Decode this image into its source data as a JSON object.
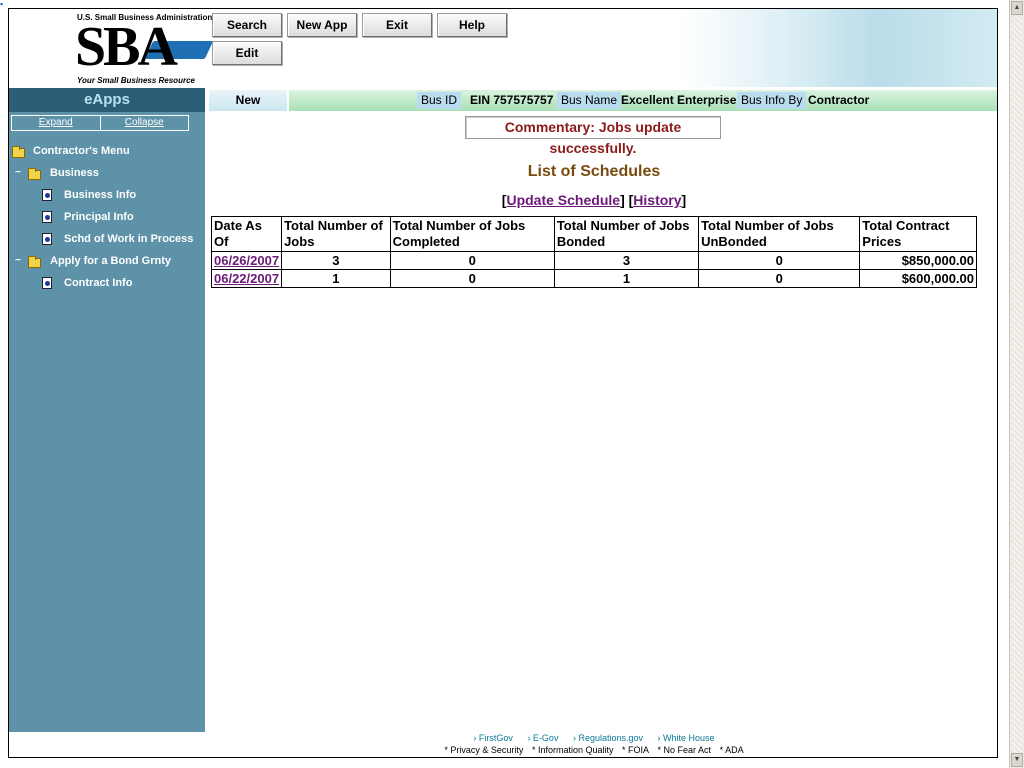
{
  "logo": {
    "tagline_top": "U.S. Small Business Administration",
    "wordmark": "SBA",
    "tagline_bottom": "Your Small Business Resource"
  },
  "toolbar": {
    "search_label": "Search",
    "new_app_label": "New App",
    "exit_label": "Exit",
    "help_label": "Help",
    "edit_label": "Edit"
  },
  "sidebar": {
    "title": "eApps",
    "expand": "Expand",
    "collapse": "Collapse",
    "items": [
      {
        "label": "Contractor's Menu"
      },
      {
        "label": "Business"
      },
      {
        "label": "Business Info"
      },
      {
        "label": "Principal Info"
      },
      {
        "label": "Schd of Work in Process"
      },
      {
        "label": "Apply for a Bond Grnty"
      },
      {
        "label": "Contract Info"
      }
    ]
  },
  "infobar": {
    "status": "New",
    "bus_id_label": "Bus ID",
    "bus_id_value": "EIN  757575757",
    "bus_name_label": "Bus Name",
    "bus_name_value": "Excellent Enterprise",
    "bus_info_by_label": "Bus Info By",
    "bus_info_by_value": "Contractor"
  },
  "commentary": "Commentary: Jobs update successfully.",
  "main": {
    "title": "List of Schedules",
    "update_link": "Update Schedule",
    "history_link": "History"
  },
  "table": {
    "headers": [
      "Date As Of",
      "Total Number of Jobs",
      "Total Number of Jobs Completed",
      "Total Number of Jobs Bonded",
      "Total Number of Jobs UnBonded",
      "Total Contract Prices"
    ],
    "rows": [
      [
        "06/26/2007",
        "3",
        "0",
        "3",
        "0",
        "$850,000.00"
      ],
      [
        "06/22/2007",
        "1",
        "0",
        "1",
        "0",
        "$600,000.00"
      ]
    ]
  },
  "footer": {
    "links": [
      "› FirstGov",
      "› E-Gov",
      "› Regulations.gov",
      "› White House"
    ],
    "links2": [
      "* Privacy & Security",
      "* Information Quality",
      "* FOIA",
      "* No Fear Act",
      "* ADA"
    ]
  }
}
